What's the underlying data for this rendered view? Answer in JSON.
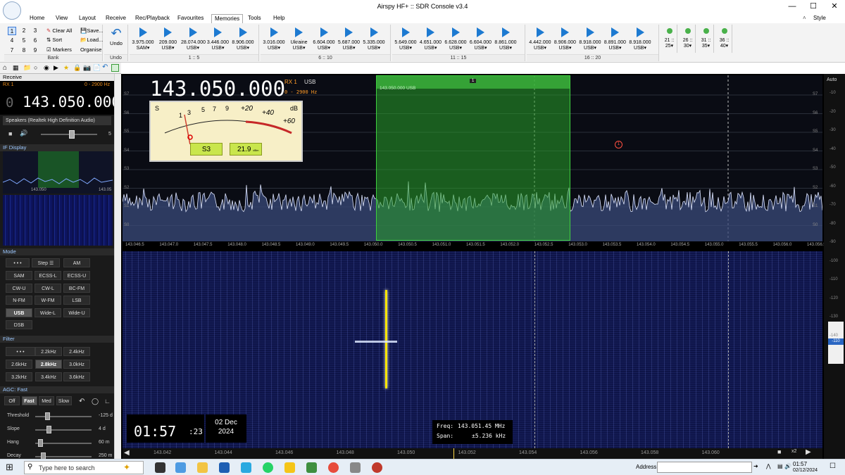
{
  "window": {
    "title": "Airspy HF+ :: SDR Console v3.4",
    "style_label": "Style"
  },
  "menu": [
    "Home",
    "View",
    "Layout",
    "Receive",
    "Rec/Playback",
    "Favourites",
    "Memories",
    "Tools",
    "Help"
  ],
  "ribbon": {
    "bank_numbers": [
      "1",
      "2",
      "3",
      "4",
      "5",
      "6",
      "7",
      "8",
      "9"
    ],
    "bank_actions": [
      "Clear All",
      "Save...",
      "Sort",
      "Load...",
      "Markers",
      "Organise"
    ],
    "bank_label": "Bank",
    "undo_label": "Undo",
    "undo_group_label": "Undo",
    "groups": [
      {
        "label": "1 :: 5",
        "mems": [
          {
            "f": "3.975.000",
            "m": "SAM"
          },
          {
            "f": "209.000",
            "m": "USB"
          },
          {
            "f": "28.074.000",
            "m": "USB"
          },
          {
            "f": "3.446.000",
            "m": "USB"
          },
          {
            "f": "8.906.000",
            "m": "USB"
          }
        ]
      },
      {
        "label": "6 :: 10",
        "mems": [
          {
            "f": "3.016.000",
            "m": "USB"
          },
          {
            "f": "Ukraine",
            "m": "USB"
          },
          {
            "f": "6.604.000",
            "m": "USB"
          },
          {
            "f": "5.687.000",
            "m": "USB"
          },
          {
            "f": "5.335.000",
            "m": "USB"
          }
        ]
      },
      {
        "label": "11 :: 15",
        "mems": [
          {
            "f": "5.649.000",
            "m": "USB"
          },
          {
            "f": "4.651.000",
            "m": "USB"
          },
          {
            "f": "6.628.000",
            "m": "USB"
          },
          {
            "f": "6.604.000",
            "m": "USB"
          },
          {
            "f": "8.861.000",
            "m": "USB"
          }
        ]
      },
      {
        "label": "16 :: 20",
        "mems": [
          {
            "f": "4.442.000",
            "m": "USB"
          },
          {
            "f": "8.906.000",
            "m": "USB"
          },
          {
            "f": "8.918.000",
            "m": "USB"
          },
          {
            "f": "8.891.000",
            "m": "USB"
          },
          {
            "f": "8.918.000",
            "m": "USB"
          }
        ]
      }
    ],
    "empty_mems": [
      {
        "a": "21 ::",
        "b": "25"
      },
      {
        "a": "26 ::",
        "b": "30"
      },
      {
        "a": "31 ::",
        "b": "35"
      },
      {
        "a": "36 ::",
        "b": "40"
      }
    ]
  },
  "receive": {
    "header": "Receive",
    "rx": "RX 1",
    "bw": "0 - 2900 Hz",
    "frequency_lead": "0",
    "frequency": "143.050.000",
    "audio_device": "Speakers (Realtek High Definition Audio)",
    "volume": "5"
  },
  "if_display": {
    "header": "IF Display",
    "f1": "143.050",
    "f2": "143.05"
  },
  "mode": {
    "header": "Mode",
    "step": "Step",
    "buttons": [
      "SAM",
      "ECSS-L",
      "ECSS-U",
      "CW-U",
      "CW-L",
      "BC-FM",
      "N-FM",
      "W-FM",
      "LSB",
      "USB",
      "Wide-L",
      "Wide-U",
      "DSB"
    ],
    "dots": "• • •",
    "am": "AM",
    "selected": "USB"
  },
  "filter": {
    "header": "Filter",
    "buttons": [
      "2.2kHz",
      "2.4kHz",
      "2.6kHz",
      "2.8kHz",
      "3.0kHz",
      "3.2kHz",
      "3.4kHz",
      "3.6kHz"
    ],
    "dots": "• • •",
    "selected": "2.8kHz"
  },
  "agc": {
    "header": "AGC: Fast",
    "buttons": [
      "Off",
      "Fast",
      "Med",
      "Slow"
    ],
    "selected": "Fast",
    "rows": [
      {
        "label": "Threshold",
        "value": "-125 d"
      },
      {
        "label": "Slope",
        "value": "4 d"
      },
      {
        "label": "Hang",
        "value": "60 m"
      },
      {
        "label": "Decay",
        "value": "250 m"
      }
    ]
  },
  "display": {
    "frequency": "143.050.000",
    "rx": "RX 1",
    "mode": "USB",
    "bw": "0 - 2900 Hz",
    "meter_scale": [
      "1",
      "3",
      "5",
      "7",
      "9",
      "+20",
      "+40",
      "+60"
    ],
    "meter_s": "S",
    "meter_db": "dB",
    "s_reading": "S3",
    "db_reading": "21.9",
    "db_unit": "dBm",
    "band_label": "143.050.000 USB",
    "marker": "1",
    "marker_red": "1",
    "auto": "Auto",
    "s_units": [
      "S7",
      "S6",
      "S5",
      "S4",
      "S3",
      "S2",
      "S1",
      "S0"
    ],
    "dbm_right": [
      "-10",
      "-20",
      "-30",
      "-40",
      "-50",
      "-60",
      "-70",
      "-80",
      "-90",
      "-100",
      "-110",
      "-120",
      "-130",
      "-140"
    ],
    "right_readout": "-110",
    "freq_ticks": [
      "143.046.5",
      "143.047.0",
      "143.047.5",
      "143.048.0",
      "143.048.5",
      "143.049.0",
      "143.049.5",
      "143.050.0",
      "143.050.5",
      "143.051.0",
      "143.051.5",
      "143.052.0",
      "143.052.5",
      "143.053.0",
      "143.053.5",
      "143.054.0",
      "143.054.5",
      "143.055.0",
      "143.055.5",
      "143.056.0",
      "143.056.5"
    ],
    "bottom_ticks": [
      "143.042",
      "143.044",
      "143.046",
      "143.048",
      "143.050",
      "143.052",
      "143.054",
      "143.056",
      "143.058",
      "143.060"
    ],
    "zoom": "x2",
    "clock": "01:57",
    "clock_sec": ":23",
    "date_day": "02 Dec",
    "date_year": "2024",
    "cursor_freq_label": "Freq:",
    "cursor_freq": "143.051.45 MHz",
    "cursor_span_label": "Span:",
    "cursor_span": "±5.236 kHz"
  },
  "taskbar": {
    "search": "Type here to search",
    "address": "Address",
    "time": "01:57",
    "date": "02/12/2024"
  }
}
